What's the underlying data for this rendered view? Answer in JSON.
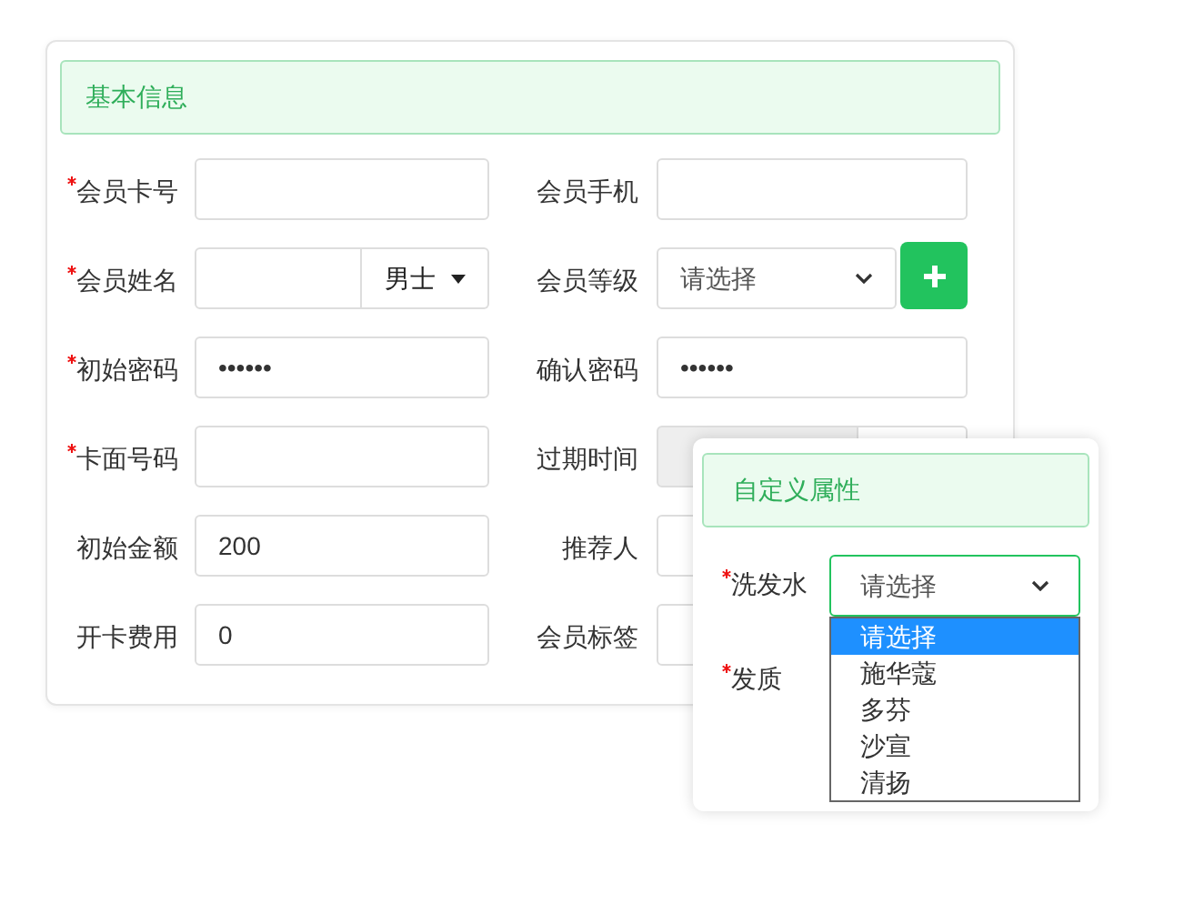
{
  "basic_info": {
    "title": "基本信息",
    "fields": [
      {
        "label": "会员卡号",
        "required": true,
        "kind": "text"
      },
      {
        "label": "会员手机",
        "required": false,
        "kind": "text"
      },
      {
        "label": "会员姓名",
        "required": true,
        "kind": "name_gender",
        "gender": "男士"
      },
      {
        "label": "会员等级",
        "required": false,
        "kind": "select_add",
        "value": "请选择"
      },
      {
        "label": "初始密码",
        "required": true,
        "kind": "text",
        "value": "••••••"
      },
      {
        "label": "确认密码",
        "required": false,
        "kind": "text",
        "value": "••••••"
      },
      {
        "label": "卡面号码",
        "required": true,
        "kind": "text"
      },
      {
        "label": "过期时间",
        "required": false,
        "kind": "disabled"
      },
      {
        "label": "初始金额",
        "required": false,
        "kind": "text",
        "value": "200"
      },
      {
        "label": "推荐人",
        "required": false,
        "kind": "text"
      },
      {
        "label": "开卡费用",
        "required": false,
        "kind": "text",
        "value": "0"
      },
      {
        "label": "会员标签",
        "required": false,
        "kind": "text"
      }
    ]
  },
  "custom_attributes": {
    "title": "自定义属性",
    "fields": [
      {
        "label": "洗发水",
        "required": true,
        "value": "请选择",
        "options": [
          {
            "label": "请选择",
            "selected": true
          },
          {
            "label": "施华蔻",
            "selected": false
          },
          {
            "label": "多芬",
            "selected": false
          },
          {
            "label": "沙宣",
            "selected": false
          },
          {
            "label": "清扬",
            "selected": false
          }
        ]
      },
      {
        "label": "发质",
        "required": true
      }
    ]
  }
}
